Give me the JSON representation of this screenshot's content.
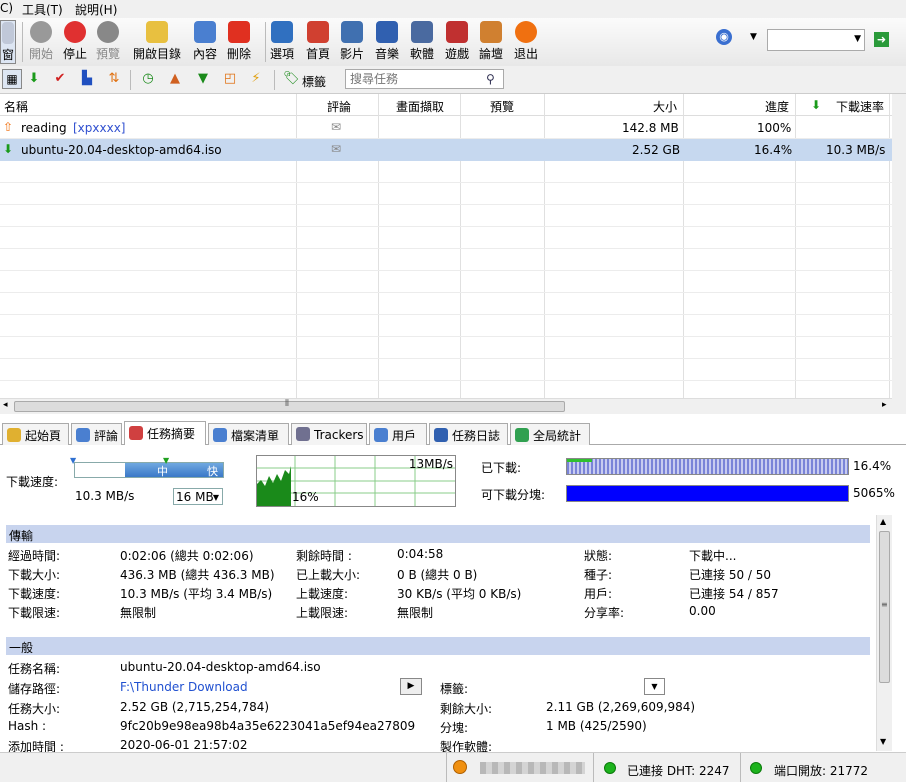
{
  "menu": {
    "items": [
      "C)",
      "工具(T)",
      "說明(H)"
    ]
  },
  "toolbar": {
    "partial_label": "窗",
    "buttons": [
      {
        "label": "開始",
        "icon": "play-icon",
        "color": "#999999",
        "disabled": true
      },
      {
        "label": "停止",
        "icon": "stop-icon",
        "color": "#e03030",
        "disabled": false
      },
      {
        "label": "預覽",
        "icon": "preview-icon",
        "color": "#888888",
        "disabled": true
      },
      {
        "label": "開啟目錄",
        "icon": "folder-icon",
        "color": "#e8c040",
        "disabled": false
      },
      {
        "label": "內容",
        "icon": "properties-icon",
        "color": "#4a7fd0",
        "disabled": false
      },
      {
        "label": "刪除",
        "icon": "delete-icon",
        "color": "#e03020",
        "disabled": false
      },
      {
        "label": "選項",
        "icon": "options-icon",
        "color": "#3070c0",
        "disabled": false
      },
      {
        "label": "首頁",
        "icon": "home-icon",
        "color": "#d04030",
        "disabled": false
      },
      {
        "label": "影片",
        "icon": "movie-icon",
        "color": "#4070b0",
        "disabled": false
      },
      {
        "label": "音樂",
        "icon": "music-icon",
        "color": "#3060b0",
        "disabled": false
      },
      {
        "label": "軟體",
        "icon": "software-icon",
        "color": "#4a6aa0",
        "disabled": false
      },
      {
        "label": "遊戲",
        "icon": "game-icon",
        "color": "#c03030",
        "disabled": false
      },
      {
        "label": "論壇",
        "icon": "forum-icon",
        "color": "#d08030",
        "disabled": false
      },
      {
        "label": "退出",
        "icon": "exit-icon",
        "color": "#f07010",
        "disabled": false
      }
    ],
    "tag_label": "標籤",
    "search_placeholder": "搜尋任務"
  },
  "list": {
    "columns": [
      "名稱",
      "評論",
      "畫面擷取",
      "預覽",
      "大小",
      "進度",
      "下載速率"
    ],
    "rows": [
      {
        "name": "reading",
        "tag": "[xpxxxx]",
        "size": "142.8 MB",
        "progress": "100%",
        "rate": "",
        "status": "upload",
        "selected": false
      },
      {
        "name": "ubuntu-20.04-desktop-amd64.iso",
        "tag": "",
        "size": "2.52 GB",
        "progress": "16.4%",
        "rate": "10.3 MB/s",
        "status": "download",
        "selected": true
      }
    ]
  },
  "tabs": [
    {
      "label": "起始頁",
      "icon": "start-page-icon",
      "color": "#e0b030"
    },
    {
      "label": "評論",
      "icon": "comments-icon",
      "color": "#4a7fd0"
    },
    {
      "label": "任務摘要",
      "icon": "task-summary-icon",
      "color": "#d04040",
      "active": true
    },
    {
      "label": "檔案清單",
      "icon": "file-list-icon",
      "color": "#4a7fd0"
    },
    {
      "label": "Trackers",
      "icon": "trackers-icon",
      "color": "#707090"
    },
    {
      "label": "用戶",
      "icon": "users-icon",
      "color": "#4a7fd0"
    },
    {
      "label": "任務日誌",
      "icon": "task-log-icon",
      "color": "#3060b0"
    },
    {
      "label": "全局統計",
      "icon": "global-stats-icon",
      "color": "#30a050"
    }
  ],
  "summary": {
    "speed_label": "下載速度:",
    "speed_value": "10.3 MB/s",
    "slider_mid": "中",
    "slider_fast": "快",
    "limit_select": "16 MB",
    "graph_max": "13MB/s",
    "graph_pct": "16%",
    "downloaded_label": "已下載:",
    "downloaded_value": "16.4%",
    "downloaded_fraction": 0.164,
    "availability_label": "可下載分塊:",
    "availability_value": "5065%"
  },
  "transfer": {
    "title": "傳輸",
    "col1": [
      [
        "經過時間:",
        "0:02:06 (總共 0:02:06)"
      ],
      [
        "下載大小:",
        "436.3 MB (總共 436.3 MB)"
      ],
      [
        "下載速度:",
        "10.3 MB/s (平均 3.4 MB/s)"
      ],
      [
        "下載限速:",
        "無限制"
      ]
    ],
    "col2": [
      [
        "剩餘時間 :",
        "0:04:58"
      ],
      [
        "已上載大小:",
        "0 B (總共 0 B)"
      ],
      [
        "上載速度:",
        "30 KB/s (平均 0 KB/s)"
      ],
      [
        "上載限速:",
        "無限制"
      ]
    ],
    "col3": [
      [
        "狀態:",
        "下載中..."
      ],
      [
        "種子:",
        "已連接 50 / 50"
      ],
      [
        "用戶:",
        "已連接 54 / 857"
      ],
      [
        "分享率:",
        "0.00"
      ]
    ]
  },
  "general": {
    "title": "一般",
    "name_label": "任務名稱:",
    "name_value": "ubuntu-20.04-desktop-amd64.iso",
    "path_label": "儲存路徑:",
    "path_value": "F:\\Thunder Download",
    "tag_label": "標籤:",
    "size_label": "任務大小:",
    "size_value": "2.52 GB (2,715,254,784)",
    "remaining_label": "剩餘大小:",
    "remaining_value": "2.11 GB (2,269,609,984)",
    "hash_label": "Hash :",
    "hash_value": "9fc20b9e98ea98b4a35e6223041a5ef94ea27809",
    "pieces_label": "分塊:",
    "pieces_value": "1 MB (425/2590)",
    "added_label": "添加時間 :",
    "added_value": "2020-06-01 21:57:02",
    "creator_label": "製作軟體:"
  },
  "status": {
    "dht": "已連接 DHT: 2247",
    "port": "端口開放: 21772"
  },
  "colors": {
    "selected_row": "#c6d8ef",
    "section_header": "#c8d4ee",
    "progress_blue": "#0000ff",
    "graph_green": "#1a8a1a"
  }
}
